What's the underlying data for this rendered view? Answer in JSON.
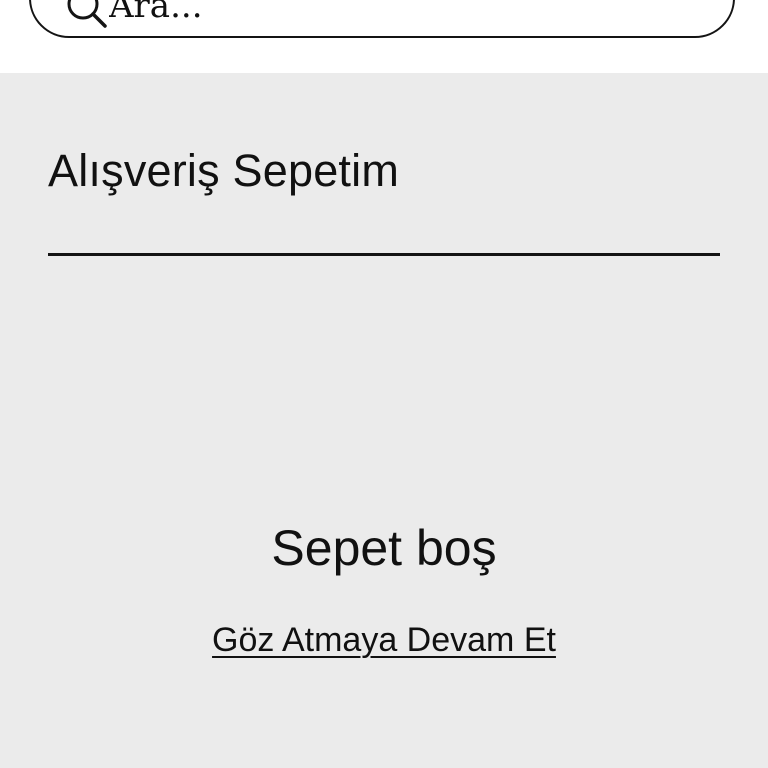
{
  "search": {
    "placeholder": "Ara...",
    "icon": "search-icon"
  },
  "cart": {
    "title": "Alışveriş Sepetim",
    "empty_message": "Sepet boş",
    "continue_link": "Göz Atmaya Devam Et"
  },
  "colors": {
    "background": "#ebebeb",
    "header_background": "#ffffff",
    "text": "#111111",
    "border": "#141414"
  }
}
